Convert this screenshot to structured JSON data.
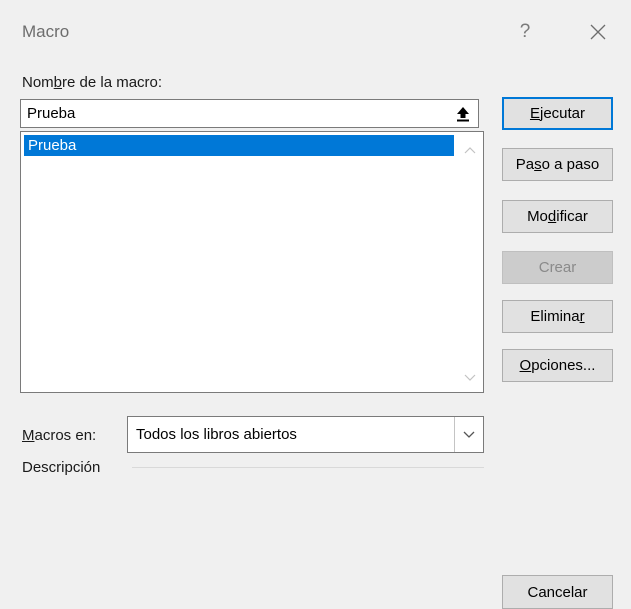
{
  "window": {
    "title": "Macro",
    "help_label": "?"
  },
  "macro_name": {
    "label_pre": "Nom",
    "label_key": "b",
    "label_post": "re de la macro:",
    "value": "Prueba"
  },
  "macro_list": {
    "items": [
      {
        "name": "Prueba",
        "selected": true
      }
    ]
  },
  "buttons": {
    "ejecutar": {
      "key": "E",
      "rest": "jecutar"
    },
    "paso": {
      "pre": "Pa",
      "key": "s",
      "post": "o a paso"
    },
    "modificar": {
      "pre": "Mo",
      "key": "d",
      "post": "ificar"
    },
    "crear": {
      "label": "Crear",
      "disabled": true
    },
    "eliminar": {
      "pre": "Elimina",
      "key": "r"
    },
    "opciones": {
      "key": "O",
      "rest": "pciones..."
    },
    "cancelar": {
      "label": "Cancelar"
    }
  },
  "macros_en": {
    "label_key": "M",
    "label_rest": "acros en:",
    "value": "Todos los libros abiertos"
  },
  "description": {
    "label": "Descripción"
  },
  "colors": {
    "accent": "#0078d7",
    "dialog_bg": "#f0f0f0",
    "button_bg": "#e1e1e1"
  }
}
